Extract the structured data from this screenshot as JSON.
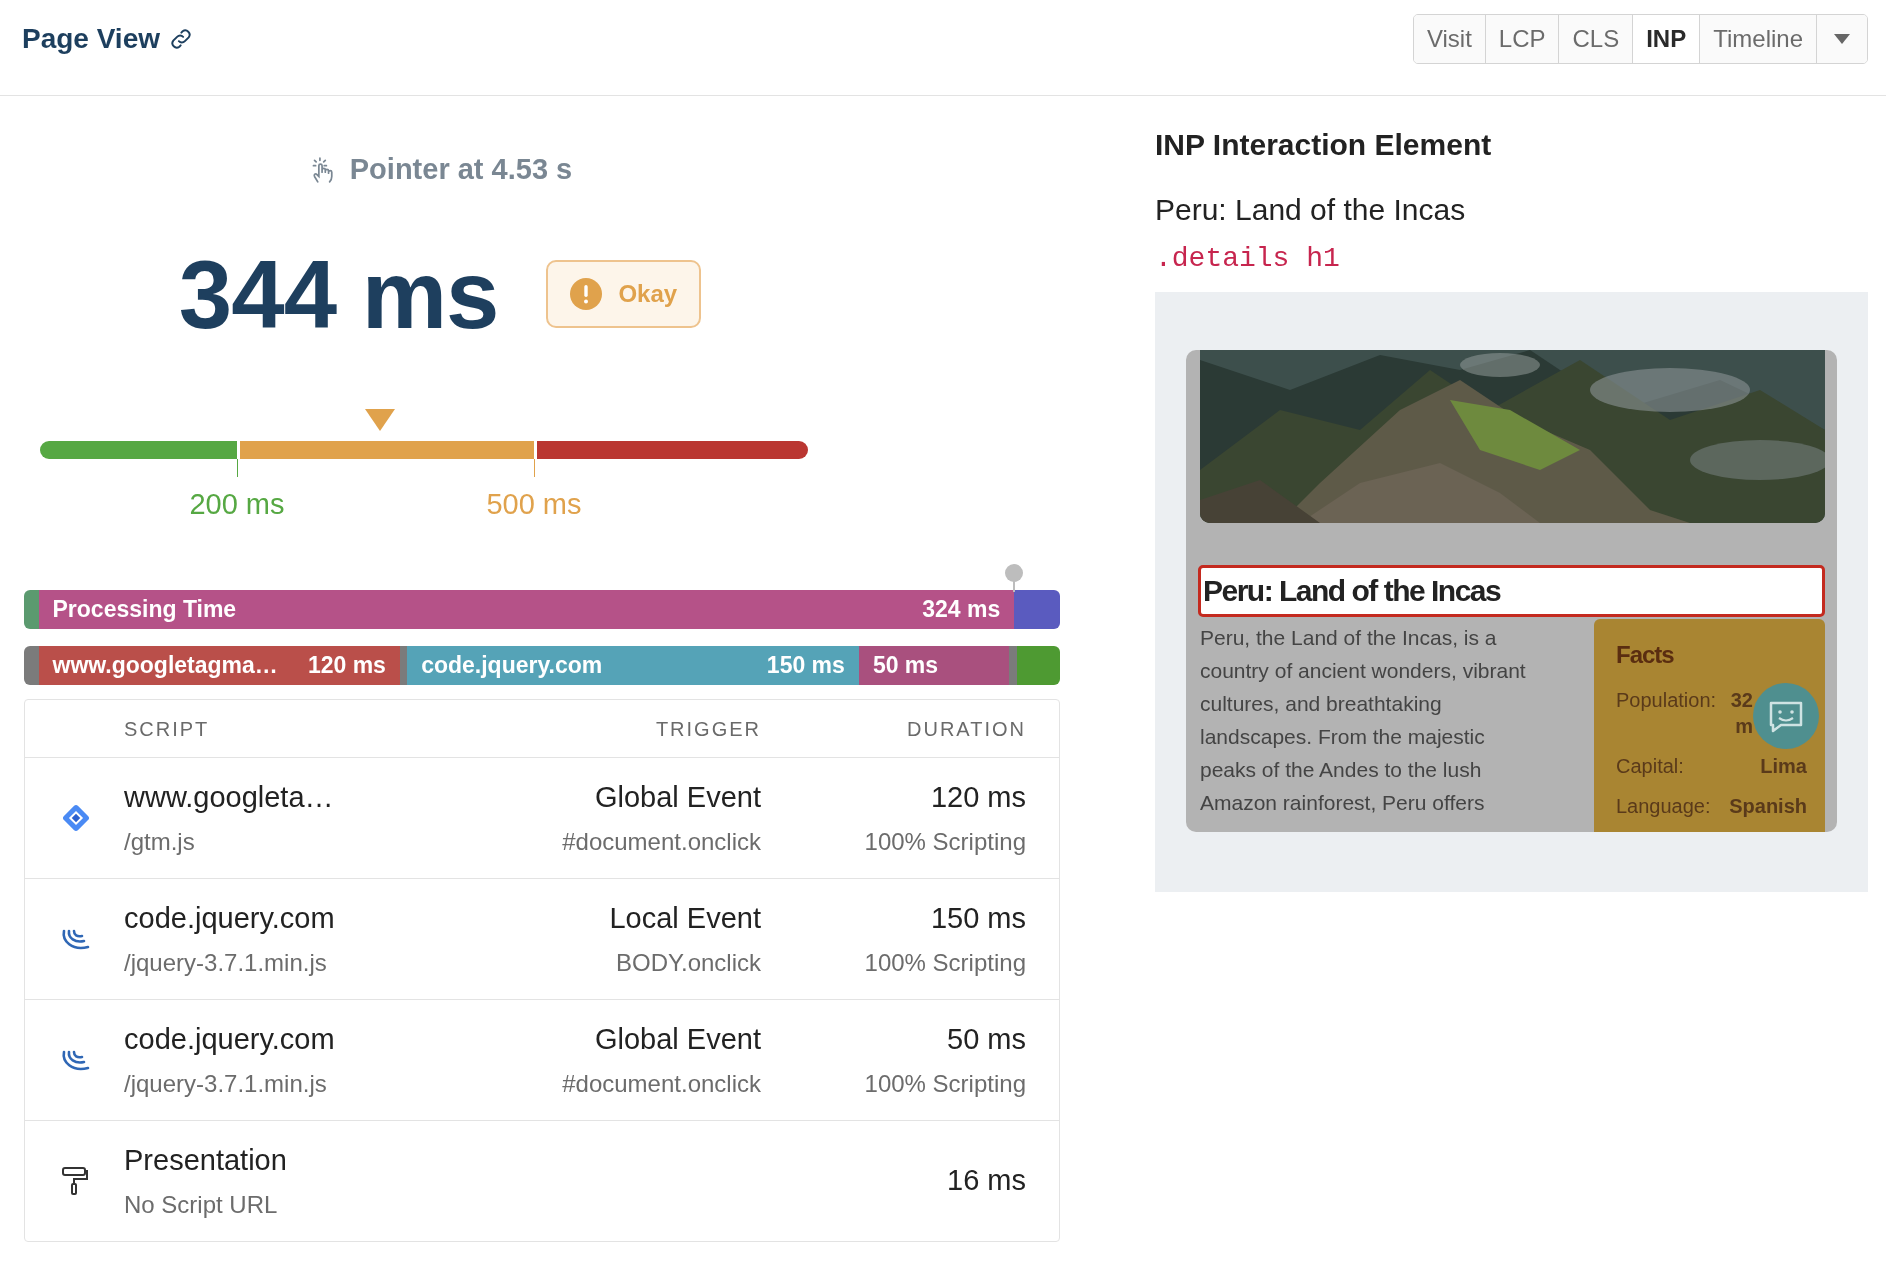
{
  "header": {
    "title": "Page View",
    "tabs": [
      {
        "label": "Visit",
        "selected": false
      },
      {
        "label": "LCP",
        "selected": false
      },
      {
        "label": "CLS",
        "selected": false
      },
      {
        "label": "INP",
        "selected": true
      },
      {
        "label": "Timeline",
        "selected": false
      }
    ]
  },
  "interaction": {
    "trigger": "Pointer at 4.53 s",
    "value": "344 ms",
    "rating": {
      "kind": "okay",
      "label": "Okay"
    }
  },
  "scale": {
    "level": 0.443,
    "thresholds": [
      "200 ms",
      "500 ms"
    ]
  },
  "processing_bar": {
    "segments": [
      {
        "kind": "input_delay",
        "color": "#5b9a6f"
      },
      {
        "kind": "timed",
        "label": "Processing Time",
        "value": "324 ms",
        "color": "#b55288"
      },
      {
        "kind": "presentation",
        "color": "#5a5bbf"
      }
    ]
  },
  "script_bar": {
    "segments": [
      {
        "kind": "input_delay",
        "color": "#7b7b7b"
      },
      {
        "kind": "timed",
        "label": "www.googletagma…",
        "value": "120 ms",
        "color": "#ba4f4a"
      },
      {
        "kind": "gap",
        "color": "#7b7b7b"
      },
      {
        "kind": "timed",
        "label": "code.jquery.com",
        "value": "150 ms",
        "color": "#55a3b7"
      },
      {
        "kind": "timed",
        "value": "50 ms",
        "color": "#a9507e"
      },
      {
        "kind": "gap",
        "color": "#7b7b7b"
      },
      {
        "kind": "presentation",
        "color": "#4e9a32"
      }
    ]
  },
  "table": {
    "columns": [
      "SCRIPT",
      "TRIGGER",
      "DURATION"
    ],
    "rows": [
      {
        "kind": "gtm",
        "script": "www.googleta…",
        "path": "/gtm.js",
        "trigger": "Global Event",
        "trigger_detail": "#document.onclick",
        "duration": "120 ms",
        "duration_detail": "100% Scripting"
      },
      {
        "kind": "jquery",
        "script": "code.jquery.com",
        "path": "/jquery-3.7.1.min.js",
        "trigger": "Local Event",
        "trigger_detail": "BODY.onclick",
        "duration": "150 ms",
        "duration_detail": "100% Scripting"
      },
      {
        "kind": "jquery",
        "script": "code.jquery.com",
        "path": "/jquery-3.7.1.min.js",
        "trigger": "Global Event",
        "trigger_detail": "#document.onclick",
        "duration": "50 ms",
        "duration_detail": "100% Scripting"
      },
      {
        "kind": "presentation",
        "script": "Presentation",
        "path": "No Script URL",
        "duration": "16 ms"
      }
    ]
  },
  "element": {
    "title": "INP Interaction Element",
    "text": "Peru: Land of the Incas",
    "selector": ".details h1",
    "preview": {
      "heading": "Peru: Land of the Incas",
      "highlighted": true,
      "paragraph": "Peru, the Land of the Incas, is a country of ancient wonders, vibrant cultures, and breathtaking landscapes. From the majestic peaks of the Andes to the lush Amazon rainforest, Peru offers",
      "facts": {
        "title": "Facts",
        "rows": [
          {
            "label": "Population:",
            "value": [
              "32",
              "m"
            ]
          },
          {
            "label": "Capital:",
            "value": [
              "Lima"
            ]
          },
          {
            "label": "Language:",
            "value": [
              "Spanish"
            ]
          }
        ]
      }
    }
  }
}
